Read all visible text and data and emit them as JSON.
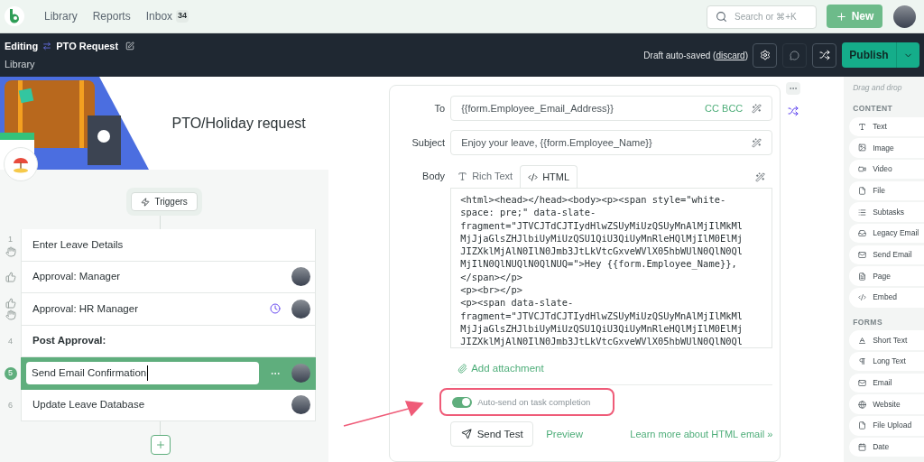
{
  "top_nav": {
    "items": [
      {
        "label": "Library",
        "selected": false
      },
      {
        "label": "Reports",
        "selected": false
      },
      {
        "label": "Inbox",
        "selected": false,
        "badge": "34"
      }
    ],
    "search": {
      "placeholder": "Search or ⌘+K"
    },
    "new_button": "New"
  },
  "editor_bar": {
    "mode": "Editing",
    "title": "PTO Request",
    "breadcrumb": "Library",
    "draft_status": "Draft auto-saved (",
    "discard_link": "discard",
    "draft_status_end": ")",
    "publish_button": "Publish"
  },
  "workflow": {
    "title": "PTO/Holiday request",
    "triggers_button": "Triggers",
    "steps": [
      {
        "kind": "form",
        "number": "1",
        "label": "Enter Leave Details",
        "assigned": false,
        "due": false,
        "selected": false
      },
      {
        "kind": "approval",
        "label": "Approval: Manager",
        "assigned": true,
        "due": false,
        "selected": false
      },
      {
        "kind": "approval-form",
        "label": "Approval: HR Manager",
        "assigned": true,
        "due": true,
        "selected": false
      },
      {
        "kind": "heading",
        "number": "4",
        "label": "Post Approval:",
        "assigned": false,
        "due": false,
        "selected": false
      },
      {
        "kind": "task",
        "number": "5",
        "label": "Send Email Confirmation",
        "assigned": true,
        "due": false,
        "selected": true
      },
      {
        "kind": "task",
        "number": "6",
        "label": "Update Leave Database",
        "assigned": true,
        "due": false,
        "selected": false
      }
    ]
  },
  "email": {
    "to_label": "To",
    "to_value": "{{form.Employee_Email_Address}}",
    "cc_bcc": "CC BCC",
    "subject_label": "Subject",
    "subject_value": "Enjoy your leave, {{form.Employee_Name}}",
    "body_label": "Body",
    "tabs": [
      {
        "kind": "rich",
        "label": "Rich Text",
        "selected": false
      },
      {
        "kind": "html",
        "label": "HTML",
        "selected": true
      }
    ],
    "html_lines": [
      "<html><head></head><body><p><span style=\"white-",
      "space: pre;\" data-slate-",
      "fragment=\"JTVCJTdCJTIydHlwZSUyMiUzQSUyMnAlMjIlMkMl",
      "MjJjaGlsZHJlbiUyMiUzQSU1QiU3QiUyMnRleHQlMjIlM0ElMj",
      "JIZXklMjAlN0IlN0Jmb3JtLkVtcGxveWVlX05hbWUlN0QlN0Ql",
      "MjIlN0QlNUQlN0QlNUQ=\">Hey {{form.Employee_Name}},",
      "</span></p>",
      "<p><br></p>",
      "<p><span data-slate-",
      "fragment=\"JTVCJTdCJTIydHlwZSUyMiUzQSUyMnAlMjIlMkMl",
      "MjJjaGlsZHJlbiUyMiUzQSU1QiU3QiUyMnRleHQlMjIlM0ElMj",
      "JIZXklMjAlN0IlN0Jmb3JtLkVtcGxveWVlX05hbWUlN0QlN0Ql"
    ],
    "add_attachment": "Add attachment",
    "auto_send": {
      "label": "Auto-send on task completion",
      "on": true
    },
    "send_test_button": "Send Test",
    "preview_link": "Preview",
    "learn_more_link": "Learn more about HTML email »"
  },
  "palette": {
    "hint": "Drag and drop",
    "sections": [
      {
        "title": "CONTENT",
        "items": [
          {
            "kind": "text",
            "label": "Text"
          },
          {
            "kind": "image",
            "label": "Image"
          },
          {
            "kind": "video",
            "label": "Video"
          },
          {
            "kind": "file",
            "label": "File"
          },
          {
            "kind": "subtasks",
            "label": "Subtasks"
          },
          {
            "kind": "legacy-email",
            "label": "Legacy Email"
          },
          {
            "kind": "send-email",
            "label": "Send Email"
          },
          {
            "kind": "page",
            "label": "Page"
          },
          {
            "kind": "embed",
            "label": "Embed"
          }
        ]
      },
      {
        "title": "FORMS",
        "items": [
          {
            "kind": "short-text",
            "label": "Short Text"
          },
          {
            "kind": "long-text",
            "label": "Long Text"
          },
          {
            "kind": "email",
            "label": "Email"
          },
          {
            "kind": "website",
            "label": "Website"
          },
          {
            "kind": "file-upload",
            "label": "File Upload"
          },
          {
            "kind": "date",
            "label": "Date"
          }
        ]
      }
    ]
  }
}
